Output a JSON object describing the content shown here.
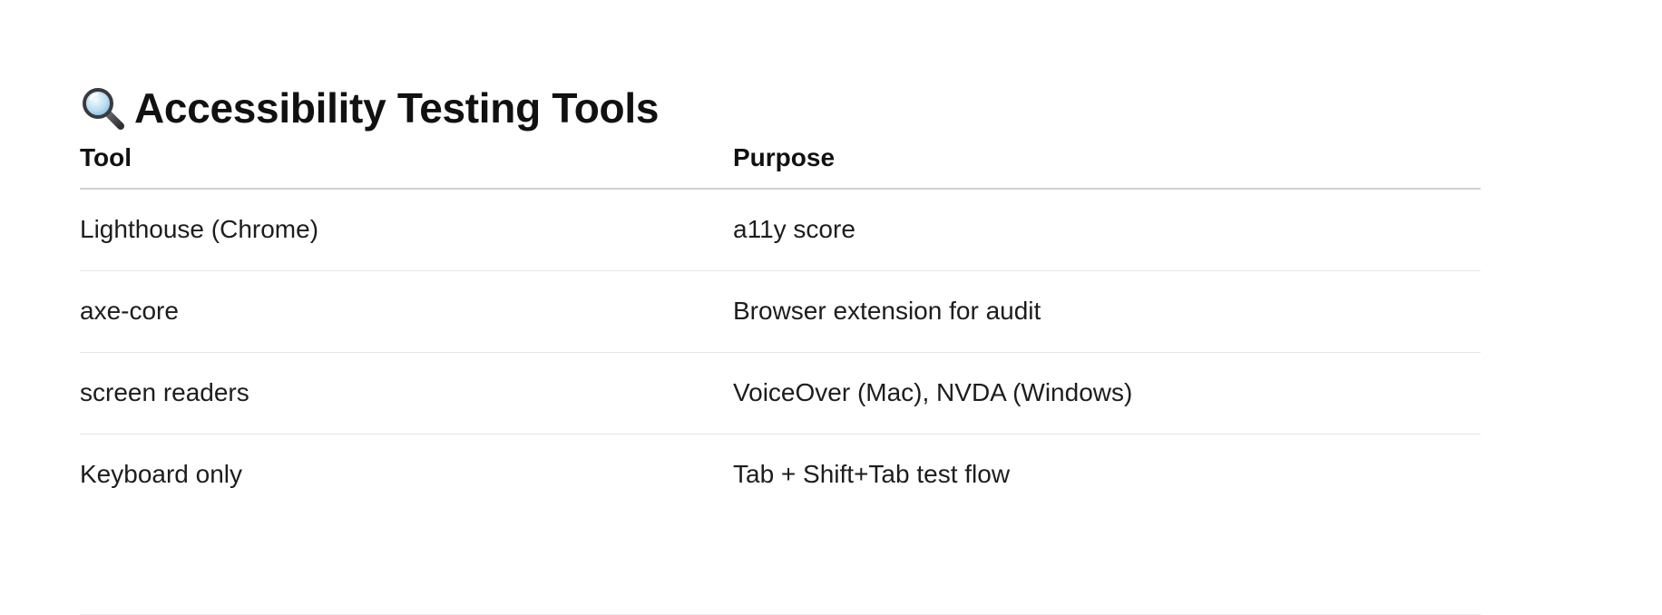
{
  "section": {
    "icon": "magnifying-glass-icon",
    "title": "Accessibility Testing Tools"
  },
  "table": {
    "headers": [
      "Tool",
      "Purpose"
    ],
    "rows": [
      {
        "tool": "Lighthouse (Chrome)",
        "purpose": "a11y score"
      },
      {
        "tool": "axe-core",
        "purpose": "Browser extension for audit"
      },
      {
        "tool": "screen readers",
        "purpose": "VoiceOver (Mac), NVDA (Windows)"
      },
      {
        "tool": "Keyboard only",
        "purpose": "Tab + Shift+Tab test flow"
      }
    ]
  },
  "colors": {
    "text": "#1d1d1f",
    "header_rule": "#cfcfd2",
    "row_rule": "#e6e6e8"
  }
}
